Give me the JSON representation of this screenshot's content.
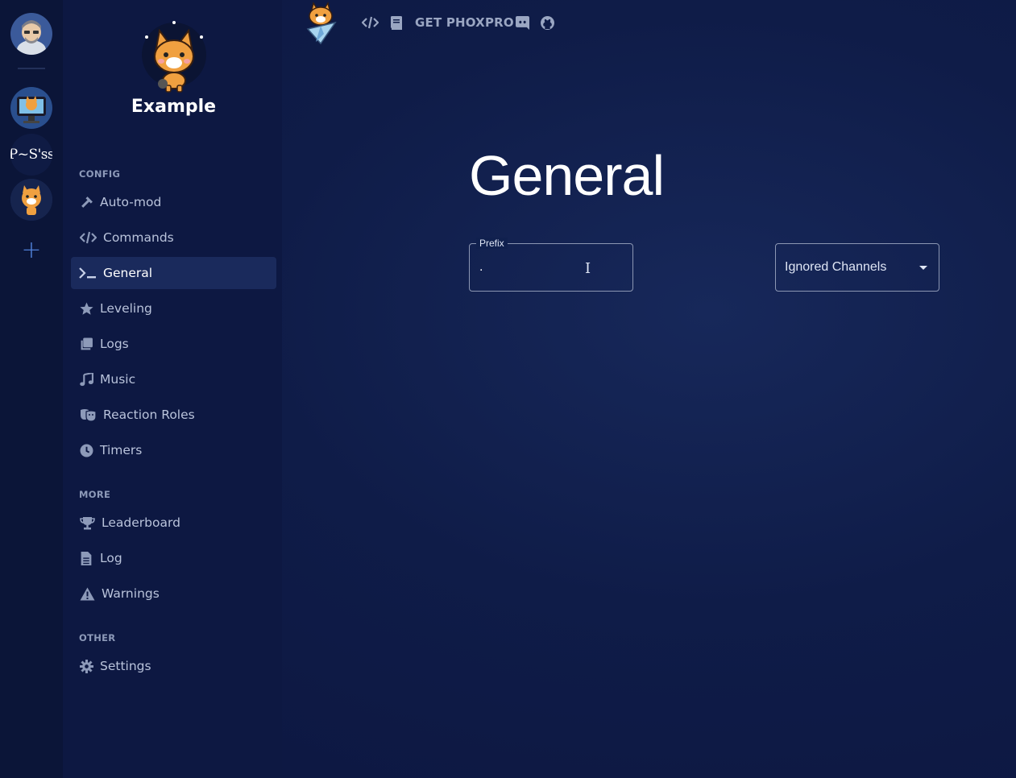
{
  "brand": {
    "name": "Example"
  },
  "rail": {
    "server_text": "P~S'ss",
    "add_label": "+"
  },
  "topbar": {
    "get_pro_label": "GET PHOXPRO"
  },
  "sidebar": {
    "sections": {
      "config": "CONFIG",
      "more": "MORE",
      "other": "OTHER"
    },
    "config_items": [
      {
        "label": "Auto-mod",
        "icon": "hammer-icon"
      },
      {
        "label": "Commands",
        "icon": "code-icon"
      },
      {
        "label": "General",
        "icon": "terminal-icon",
        "active": true
      },
      {
        "label": "Leveling",
        "icon": "star-icon"
      },
      {
        "label": "Logs",
        "icon": "copy-icon"
      },
      {
        "label": "Music",
        "icon": "music-icon"
      },
      {
        "label": "Reaction Roles",
        "icon": "masks-icon"
      },
      {
        "label": "Timers",
        "icon": "clock-icon"
      }
    ],
    "more_items": [
      {
        "label": "Leaderboard",
        "icon": "trophy-icon"
      },
      {
        "label": "Log",
        "icon": "file-icon"
      },
      {
        "label": "Warnings",
        "icon": "warning-icon"
      }
    ],
    "other_items": [
      {
        "label": "Settings",
        "icon": "gear-icon"
      }
    ]
  },
  "main": {
    "title": "General",
    "prefix": {
      "label": "Prefix",
      "value": "."
    },
    "ignored_channels": {
      "label": "Ignored Channels"
    }
  },
  "colors": {
    "background": "#0f1c48",
    "sidebar": "#0d1842",
    "active_item": "#1a2a5c",
    "accent_plus": "#4f7fd6"
  }
}
